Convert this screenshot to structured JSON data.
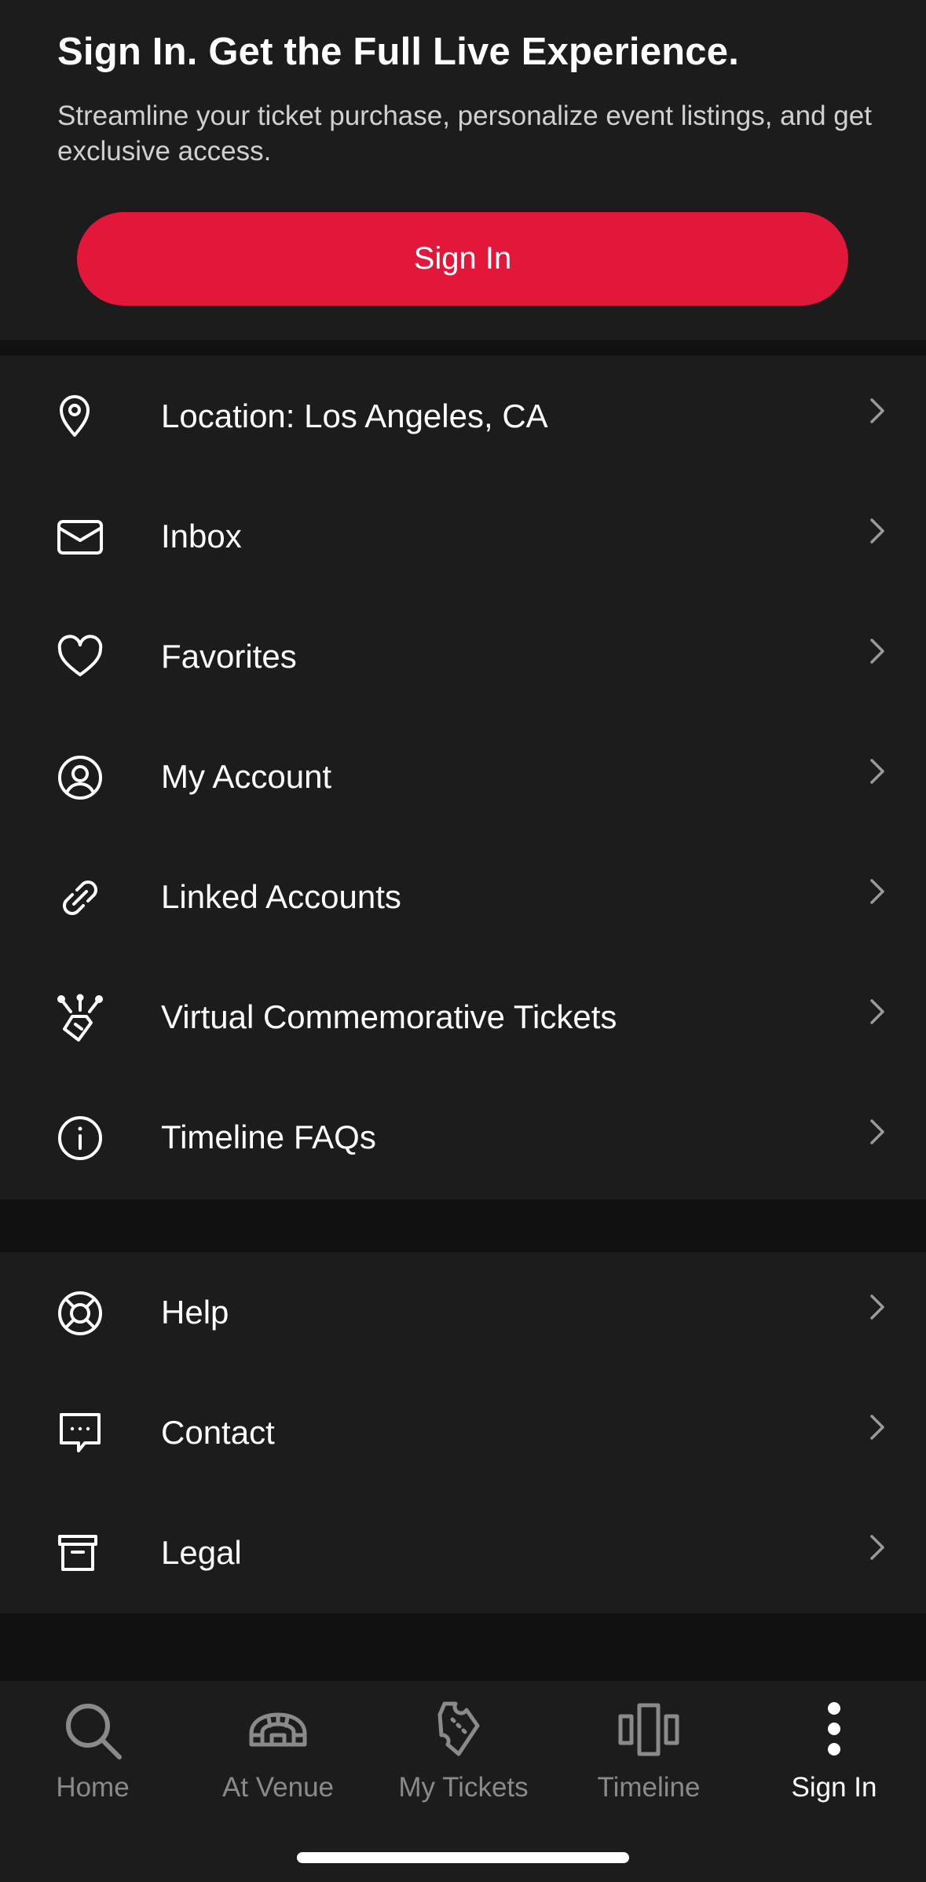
{
  "header": {
    "title": "Sign In. Get the Full Live Experience.",
    "subtitle": "Streamline your ticket purchase, personalize event listings, and get exclusive access.",
    "signin_label": "Sign In"
  },
  "menu_primary": [
    {
      "label": "Location: Los Angeles, CA",
      "icon": "location-pin-icon"
    },
    {
      "label": "Inbox",
      "icon": "mail-icon"
    },
    {
      "label": "Favorites",
      "icon": "heart-icon"
    },
    {
      "label": "My Account",
      "icon": "user-circle-icon"
    },
    {
      "label": "Linked Accounts",
      "icon": "link-icon"
    },
    {
      "label": "Virtual Commemorative Tickets",
      "icon": "commemorative-ticket-icon"
    },
    {
      "label": "Timeline FAQs",
      "icon": "info-icon"
    }
  ],
  "menu_secondary": [
    {
      "label": "Help",
      "icon": "lifebuoy-icon"
    },
    {
      "label": "Contact",
      "icon": "chat-bubble-icon"
    },
    {
      "label": "Legal",
      "icon": "archive-box-icon"
    }
  ],
  "tabbar": [
    {
      "label": "Home",
      "icon": "search-icon",
      "active": false
    },
    {
      "label": "At Venue",
      "icon": "stadium-icon",
      "active": false
    },
    {
      "label": "My Tickets",
      "icon": "ticket-icon",
      "active": false
    },
    {
      "label": "Timeline",
      "icon": "timeline-icon",
      "active": false
    },
    {
      "label": "Sign In",
      "icon": "more-vertical-icon",
      "active": true
    }
  ],
  "colors": {
    "accent": "#e3173a",
    "surface": "#1c1c1c",
    "background": "#111111",
    "tab_inactive": "#8a8a8a"
  }
}
